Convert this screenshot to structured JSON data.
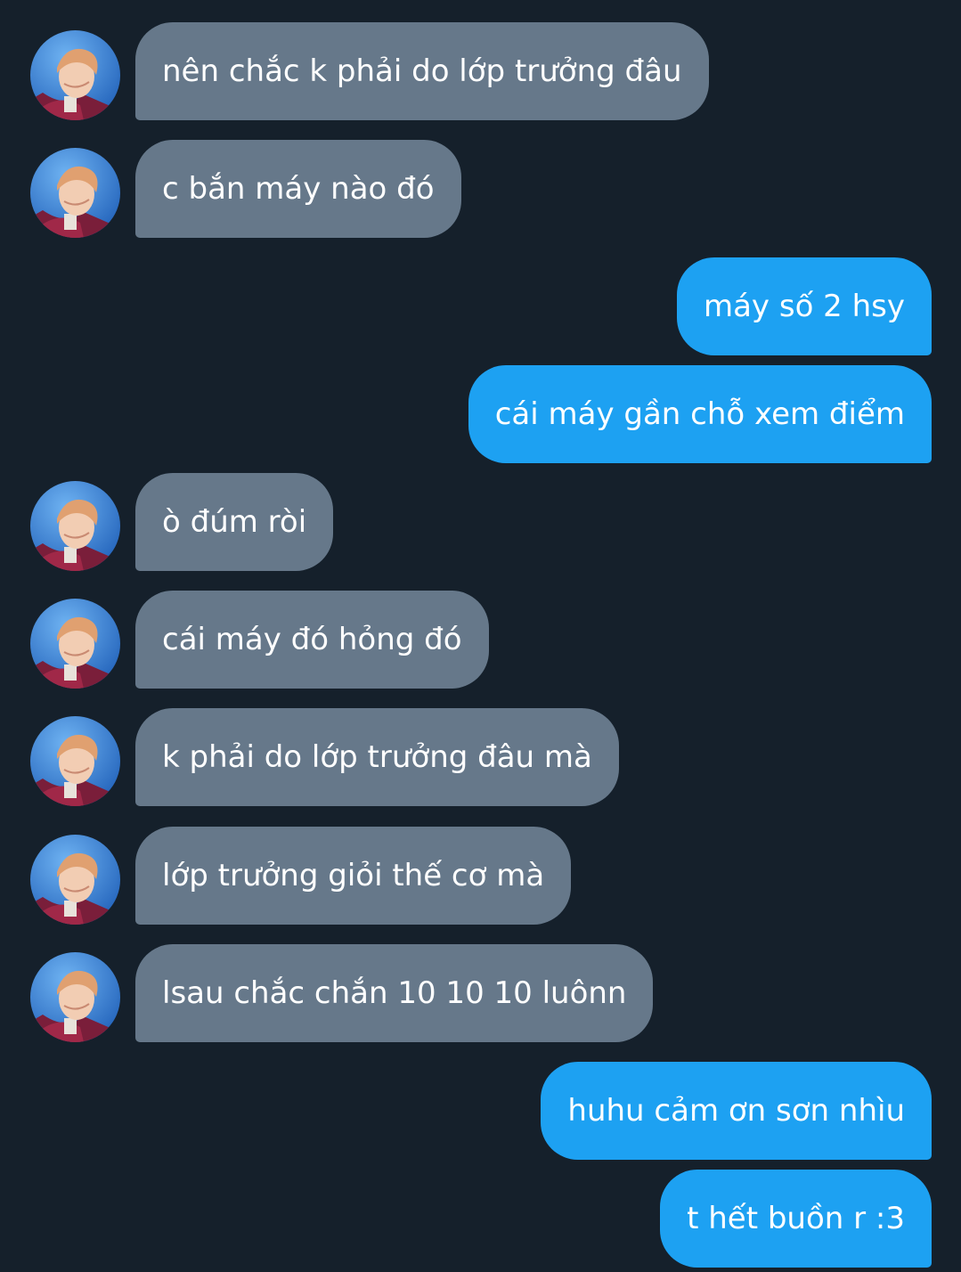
{
  "conversation": {
    "messages": [
      {
        "direction": "incoming",
        "text": "nên chắc k phải do lớp trưởng đâu",
        "avatar_icon": "contact-avatar-photo"
      },
      {
        "direction": "incoming",
        "text": "c bắn máy nào đó",
        "avatar_icon": "contact-avatar-photo"
      },
      {
        "direction": "outgoing",
        "text": "máy số 2 hsy"
      },
      {
        "direction": "outgoing",
        "text": "cái máy gần chỗ xem điểm"
      },
      {
        "direction": "incoming",
        "text": "ò đúm ròi",
        "avatar_icon": "contact-avatar-photo"
      },
      {
        "direction": "incoming",
        "text": "cái máy đó hỏng đó",
        "avatar_icon": "contact-avatar-photo"
      },
      {
        "direction": "incoming",
        "text": "k phải do lớp trưởng đâu mà",
        "avatar_icon": "contact-avatar-photo"
      },
      {
        "direction": "incoming",
        "text": "lớp trưởng giỏi thế cơ mà",
        "avatar_icon": "contact-avatar-photo"
      },
      {
        "direction": "incoming",
        "text": "lsau chắc chắn 10 10 10 luônn",
        "avatar_icon": "contact-avatar-photo"
      },
      {
        "direction": "outgoing",
        "text": "huhu cảm ơn sơn nhìu"
      },
      {
        "direction": "outgoing",
        "text": "t hết buồn r :3"
      }
    ]
  },
  "colors": {
    "background": "#15202b",
    "incoming_bubble": "#66788a",
    "outgoing_bubble": "#1da1f2",
    "text": "#ffffff"
  }
}
